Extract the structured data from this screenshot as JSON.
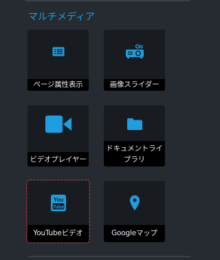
{
  "section": {
    "title": "マルチメディア"
  },
  "tiles": [
    {
      "label": "ページ属性表示",
      "icon": "page-attributes-icon",
      "selected": false
    },
    {
      "label": "画像スライダー",
      "icon": "projector-icon",
      "selected": false
    },
    {
      "label": "ビデオプレイヤー",
      "icon": "video-camera-icon",
      "selected": false
    },
    {
      "label": "ドキュメントライブラリ",
      "icon": "folder-icon",
      "selected": false
    },
    {
      "label": "YouTubeビデオ",
      "icon": "youtube-icon",
      "selected": true
    },
    {
      "label": "Googleマップ",
      "icon": "map-pin-icon",
      "selected": false
    }
  ],
  "colors": {
    "accent": "#1e9ee0",
    "background": "#262b31",
    "tile": "#181c21",
    "label_bar": "#000000",
    "selection": "#c0282f"
  }
}
